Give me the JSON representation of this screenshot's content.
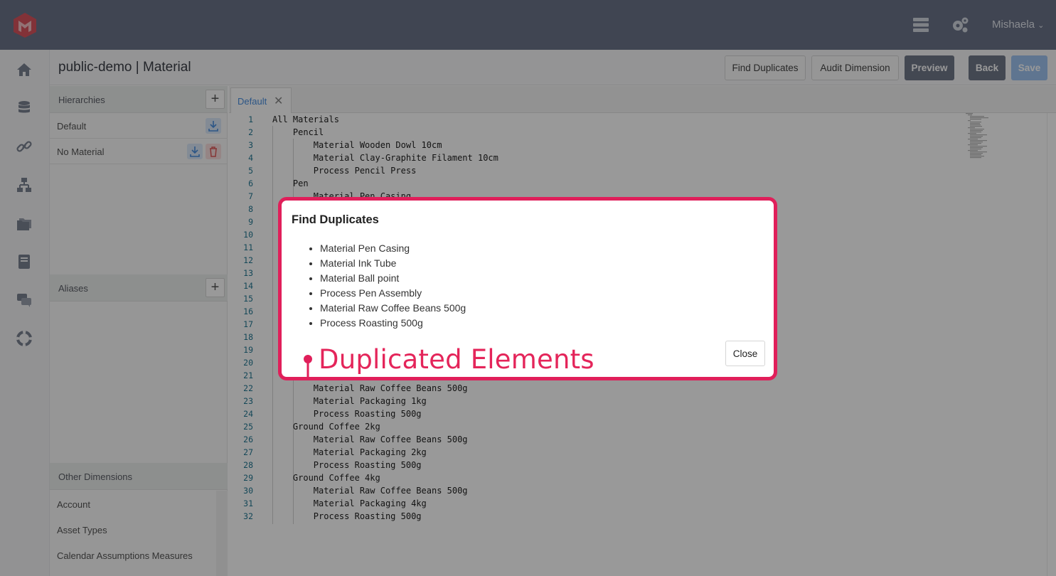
{
  "topbar": {
    "logo_icon": "app-logo-icon",
    "server_icon": "server-icon",
    "settings_icon": "gears-icon",
    "user_name": "Mishaela",
    "user_chevron": "chevron-down-icon"
  },
  "rail": {
    "icons": [
      "home-icon",
      "database-icon",
      "link-icon",
      "hierarchy-icon",
      "folders-icon",
      "book-icon",
      "chat-icon",
      "lifebuoy-icon"
    ]
  },
  "header": {
    "title": "public-demo | Material",
    "buttons": {
      "find_duplicates": "Find Duplicates",
      "audit_dimension": "Audit Dimension",
      "preview": "Preview",
      "back": "Back",
      "save": "Save"
    }
  },
  "sidebar": {
    "hierarchies_label": "Hierarchies",
    "hierarchies": [
      {
        "label": "Default"
      },
      {
        "label": "No Material"
      }
    ],
    "aliases_label": "Aliases",
    "other_dimensions_label": "Other Dimensions",
    "other_dimensions": [
      "Account",
      "Asset Types",
      "Calendar Assumptions Measures"
    ]
  },
  "tabs": [
    {
      "label": "Default",
      "close": "✕"
    }
  ],
  "editor": {
    "lines": [
      {
        "n": "1",
        "text": "All Materials"
      },
      {
        "n": "2",
        "text": "    Pencil"
      },
      {
        "n": "3",
        "text": "        Material Wooden Dowl 10cm"
      },
      {
        "n": "4",
        "text": "        Material Clay-Graphite Filament 10cm"
      },
      {
        "n": "5",
        "text": "        Process Pencil Press"
      },
      {
        "n": "6",
        "text": "    Pen"
      },
      {
        "n": "7",
        "text": "        Material Pen Casing"
      },
      {
        "n": "8",
        "text": ""
      },
      {
        "n": "9",
        "text": ""
      },
      {
        "n": "10",
        "text": ""
      },
      {
        "n": "11",
        "text": ""
      },
      {
        "n": "12",
        "text": ""
      },
      {
        "n": "13",
        "text": ""
      },
      {
        "n": "14",
        "text": ""
      },
      {
        "n": "15",
        "text": ""
      },
      {
        "n": "16",
        "text": ""
      },
      {
        "n": "17",
        "text": ""
      },
      {
        "n": "18",
        "text": ""
      },
      {
        "n": "19",
        "text": ""
      },
      {
        "n": "20",
        "text": ""
      },
      {
        "n": "21",
        "text": ""
      },
      {
        "n": "22",
        "text": "        Material Raw Coffee Beans 500g"
      },
      {
        "n": "23",
        "text": "        Material Packaging 1kg"
      },
      {
        "n": "24",
        "text": "        Process Roasting 500g"
      },
      {
        "n": "25",
        "text": "    Ground Coffee 2kg"
      },
      {
        "n": "26",
        "text": "        Material Raw Coffee Beans 500g"
      },
      {
        "n": "27",
        "text": "        Material Packaging 2kg"
      },
      {
        "n": "28",
        "text": "        Process Roasting 500g"
      },
      {
        "n": "29",
        "text": "    Ground Coffee 4kg"
      },
      {
        "n": "30",
        "text": "        Material Raw Coffee Beans 500g"
      },
      {
        "n": "31",
        "text": "        Material Packaging 4kg"
      },
      {
        "n": "32",
        "text": "        Process Roasting 500g"
      }
    ]
  },
  "modal": {
    "title": "Find Duplicates",
    "items": [
      "Material Pen Casing",
      "Material Ink Tube",
      "Material Ball point",
      "Process Pen Assembly",
      "Material Raw Coffee Beans 500g",
      "Process Roasting 500g"
    ],
    "close_label": "Close"
  },
  "annotation": {
    "text": "Duplicated Elements",
    "color": "#e01f5a"
  }
}
